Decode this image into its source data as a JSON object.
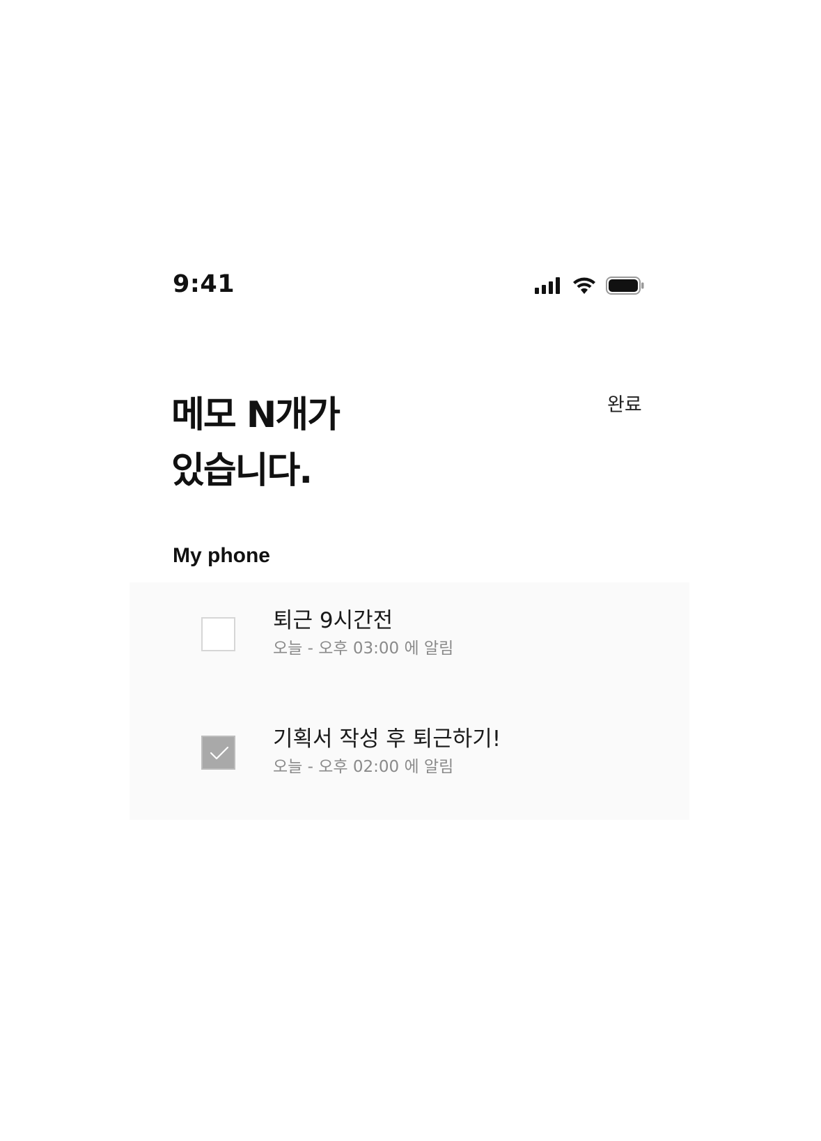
{
  "status_bar": {
    "time": "9:41",
    "icons": [
      "cellular-signal-icon",
      "wifi-icon",
      "battery-icon"
    ]
  },
  "header": {
    "title_line1": "메모 N개가",
    "title_line2": "있습니다.",
    "done_label": "완료"
  },
  "section": {
    "title": "My phone"
  },
  "memos": [
    {
      "title": "퇴근 9시간전",
      "subtitle": "오늘 - 오후 03:00 에 알림",
      "checked": false
    },
    {
      "title": "기획서 작성 후 퇴근하기!",
      "subtitle": "오늘 - 오후 02:00 에 알림",
      "checked": true
    }
  ],
  "colors": {
    "panel_background": "#fafafa",
    "checkbox_checked": "#a9a9a9",
    "subtitle_text": "#8a8a8a"
  }
}
